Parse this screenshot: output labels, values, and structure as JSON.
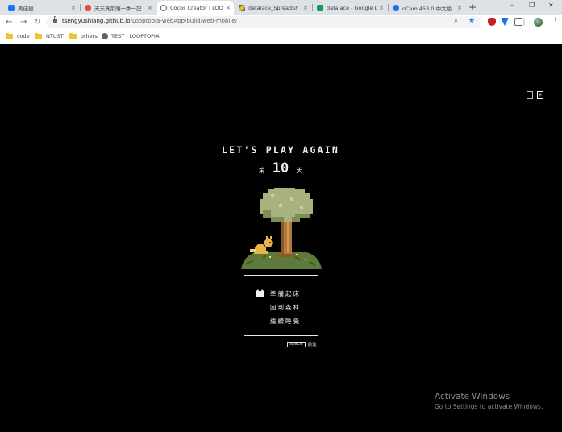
{
  "browser": {
    "tabs": [
      {
        "title": "美佳雞",
        "active": false,
        "color": "#1877f2"
      },
      {
        "title": "天天真菜頭一季一記",
        "active": false,
        "color": "#e8453c"
      },
      {
        "title": "Cocos Creator | LOO",
        "active": true,
        "color": "#5f6368"
      },
      {
        "title": "datalace_SpreadSh",
        "active": false,
        "color": "#fbbc04"
      },
      {
        "title": "datalace - Google D",
        "active": false,
        "color": "#0f9d58"
      },
      {
        "title": "oCam 453.0 中文版",
        "active": false,
        "color": "#1a73e8"
      }
    ],
    "tab_close": "×",
    "new_tab": "+",
    "window_controls": {
      "minimize": "–",
      "restore": "❐",
      "close": "✕"
    },
    "nav": {
      "back": "←",
      "forward": "→",
      "reload": "↻"
    },
    "url": {
      "domain": "tsengyushiang.github.io",
      "path": "/Looptopia-webApp/build/web-mobile/"
    },
    "omnibox_icons": {
      "zoom": "⌕",
      "star": "★"
    },
    "extension_colors": [
      "#c5221f",
      "#1a73e8",
      "#5f6368",
      "#5f6368"
    ],
    "menu_icon": "⋮",
    "bookmarks": [
      {
        "label": "code",
        "icon": "folder-icon"
      },
      {
        "label": "NTUST",
        "icon": "folder-icon"
      },
      {
        "label": "others",
        "icon": "folder-icon"
      },
      {
        "label": "TEST | LOOPTOPIA",
        "icon": "globe-icon"
      }
    ]
  },
  "game": {
    "corner_buttons": [
      "",
      "+"
    ],
    "headline": "LET'S PLAY AGAIN",
    "day": {
      "prefix": "第",
      "number": "10",
      "suffix": "天"
    },
    "menu": [
      {
        "label": "準備起床",
        "selected": true
      },
      {
        "label": "回到森林",
        "selected": false
      },
      {
        "label": "繼續睡覺",
        "selected": false
      }
    ],
    "hint": {
      "key": "space",
      "action": "前進"
    },
    "colors": {
      "foliage": "#a7b27e",
      "foliage_shade": "#7f8c55",
      "trunk": "#b07a3c",
      "grass": "#5d7a3c",
      "fox": "#e8b449"
    }
  },
  "os_watermark": {
    "line1": "Activate Windows",
    "line2": "Go to Settings to activate Windows."
  }
}
